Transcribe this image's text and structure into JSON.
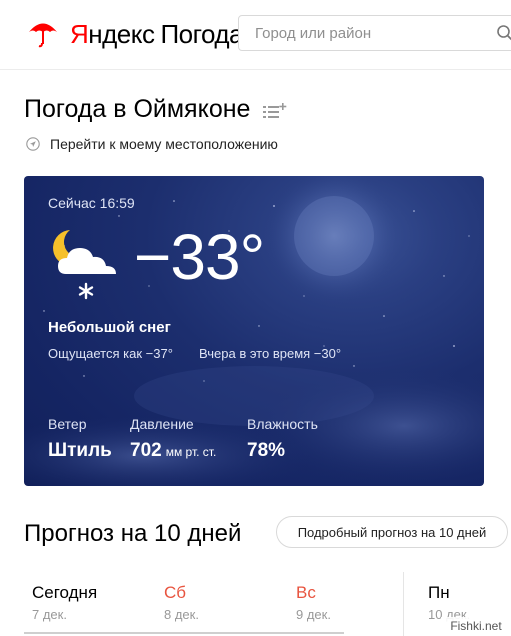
{
  "brand": {
    "logo_y": "Я",
    "logo_rest": "ндекс",
    "logo_pogoda": "Погода",
    "umbrella_color": "#f00"
  },
  "search": {
    "placeholder": "Город или район",
    "icon": "search-icon"
  },
  "page": {
    "title": "Погода в Оймяконе",
    "locate_label": "Перейти к моему местоположению"
  },
  "current": {
    "time_label": "Сейчас 16:59",
    "temperature": "−33°",
    "condition": "Небольшой снег",
    "condition_icon": "moon-cloud-snow-icon",
    "feels_like": "Ощущается как −37°",
    "yesterday": "Вчера в это время −30°",
    "stats": [
      {
        "label": "Ветер",
        "value": "Штиль",
        "unit": ""
      },
      {
        "label": "Давление",
        "value": "702",
        "unit": "мм рт. ст."
      },
      {
        "label": "Влажность",
        "value": "78%",
        "unit": ""
      }
    ],
    "card_color": "#1c2e6e"
  },
  "forecast": {
    "title": "Прогноз на 10 дней",
    "button_label": "Подробный прогноз на 10 дней",
    "days": [
      {
        "name": "Сегодня",
        "date": "7 дек.",
        "weekend": false
      },
      {
        "name": "Сб",
        "date": "8 дек.",
        "weekend": true
      },
      {
        "name": "Вс",
        "date": "9 дек.",
        "weekend": true
      },
      {
        "name": "Пн",
        "date": "10 дек.",
        "weekend": false
      }
    ],
    "weekend_color": "#e8543f"
  },
  "watermark": "Fishki.net"
}
